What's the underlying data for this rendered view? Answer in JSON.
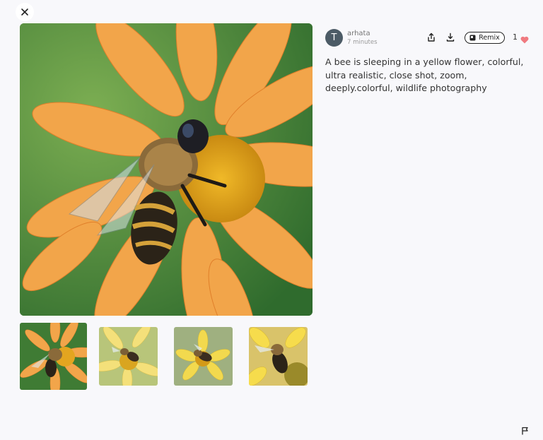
{
  "header": {
    "close_icon": "close-icon"
  },
  "post": {
    "author": {
      "avatar_initial": "T",
      "name": "arhata",
      "time": "7 minutes"
    },
    "actions": {
      "share_icon": "share-icon",
      "download_icon": "download-icon",
      "remix_label": "Remix",
      "like_count": "1",
      "like_color": "#f07a80"
    },
    "prompt": "A bee is sleeping in a yellow flower, colorful, ultra realistic, close shot, zoom, deeply.colorful, wildlife photography"
  },
  "gallery": {
    "selected_index": 0,
    "thumbnail_count": 4
  },
  "footer": {
    "report_icon": "flag-icon"
  }
}
